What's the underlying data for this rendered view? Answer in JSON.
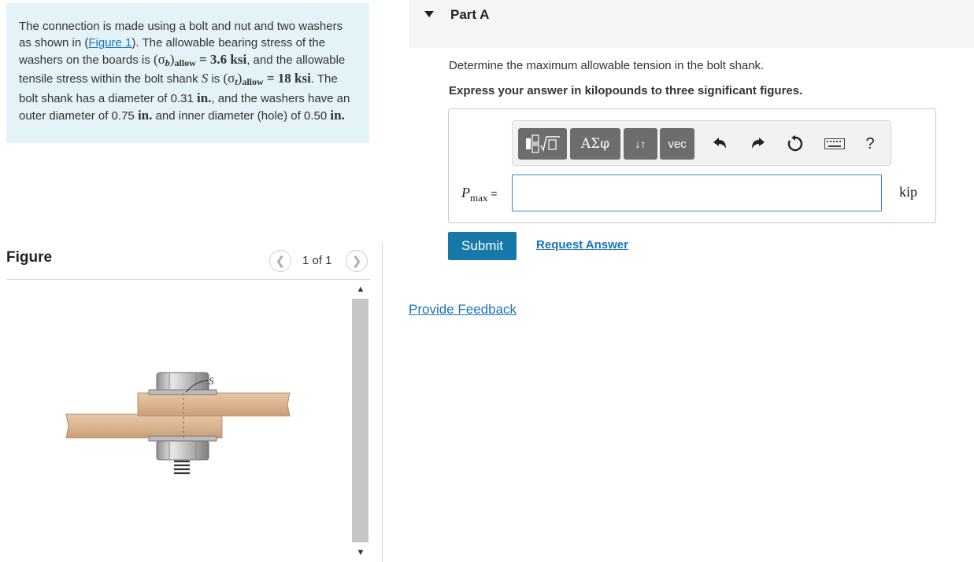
{
  "problem": {
    "text_1": "The connection is made using a bolt and nut and two washers as shown in (",
    "figure_link": "Figure 1",
    "text_2": "). The allowable bearing stress of the washers on the boards is",
    "sigma_b": "(σ",
    "sigma_b_sub": "b",
    "allow": "allow",
    "sigma_b_value": "= 3.6 ksi",
    "text_3": ", and the allowable tensile stress within the bolt shank",
    "shank_symbol": "S",
    "text_4": "is",
    "sigma_t": "(σ",
    "sigma_t_sub": "t",
    "sigma_t_value": "= 18 ksi",
    "text_5": ". The bolt shank has a diameter of 0.31",
    "unit_in": "in.",
    "text_6": ", and the washers have an outer diameter of 0.75",
    "text_7": "and inner diameter (hole) of 0.50"
  },
  "figure_panel": {
    "title": "Figure",
    "pager": "1 of 1",
    "prev_icon": "chevron-left-icon",
    "next_icon": "chevron-right-icon",
    "figure_label": "S"
  },
  "part": {
    "title": "Part A",
    "question": "Determine the maximum allowable tension in the bolt shank.",
    "instruction": "Express your answer in kilopounds to three significant figures."
  },
  "toolbar": {
    "greek_label": "ΑΣφ",
    "arrows_label": "↓↑",
    "vec_label": "vec",
    "help_label": "?"
  },
  "answer": {
    "variable": "P",
    "variable_sub": "max",
    "equals": "=",
    "value": "",
    "unit": "kip"
  },
  "actions": {
    "submit": "Submit",
    "request": "Request Answer",
    "feedback": "Provide Feedback"
  },
  "colors": {
    "problem_bg": "#e3f3f8",
    "link": "#1a73b6",
    "submit_bg": "#1779a8",
    "toolbar_btn": "#6d6d6d"
  }
}
